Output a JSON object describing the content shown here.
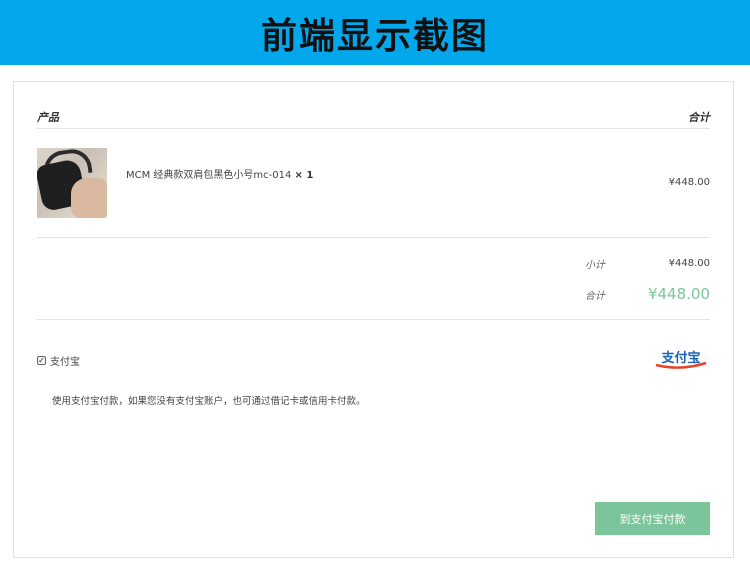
{
  "banner": {
    "title": "前端显示截图",
    "color": "#03a7ec"
  },
  "table": {
    "col_product": "产品",
    "col_total": "合计"
  },
  "order_item": {
    "name": "MCM 经典款双肩包黑色小号mc-014",
    "qty": "× 1",
    "price": "¥448.00",
    "image": "product-photo-black-backpack"
  },
  "summary": {
    "subtotal_label": "小计",
    "subtotal_value": "¥448.00",
    "total_label": "合计",
    "total_value": "¥448.00"
  },
  "payment": {
    "method_label": "支付宝",
    "checked": true,
    "logo_text": "支付宝",
    "description": "使用支付宝付款，如果您没有支付宝账户，也可通过借记卡或信用卡付款。",
    "button_label": "到支付宝付款"
  },
  "colors": {
    "accent": "#7cc59a",
    "alipay_red": "#e8432c",
    "alipay_blue": "#1a64b4"
  }
}
